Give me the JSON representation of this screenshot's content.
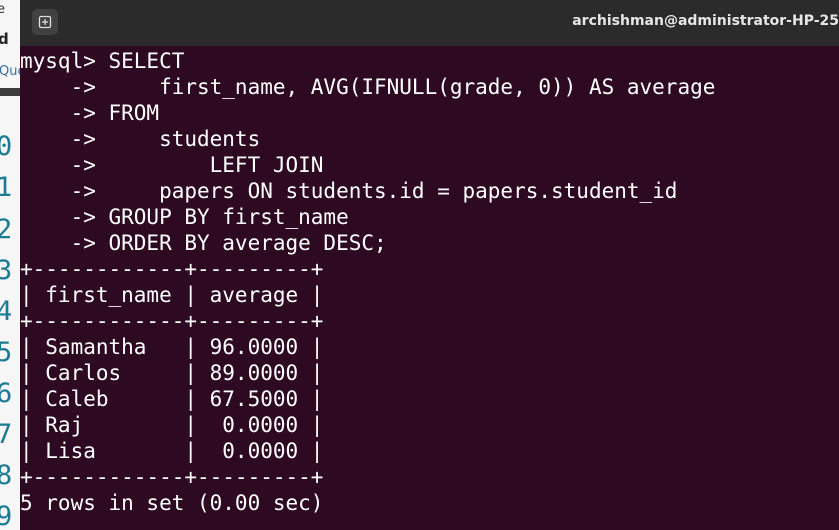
{
  "background_editor": {
    "partial_label_top": "e",
    "partial_label_tab": "d",
    "partial_label_query": "Que",
    "line_numbers": [
      "0",
      "1",
      "2",
      "3",
      "4",
      "5",
      "6",
      "7",
      "8",
      "9"
    ]
  },
  "terminal": {
    "title": "archishman@administrator-HP-25",
    "new_tab_icon": "new-tab-icon",
    "lines": [
      "mysql> SELECT",
      "    ->     first_name, AVG(IFNULL(grade, 0)) AS average",
      "    -> FROM",
      "    ->     students",
      "    ->         LEFT JOIN",
      "    ->     papers ON students.id = papers.student_id",
      "    -> GROUP BY first_name",
      "    -> ORDER BY average DESC;",
      "+------------+---------+",
      "| first_name | average |",
      "+------------+---------+",
      "| Samantha   | 96.0000 |",
      "| Carlos     | 89.0000 |",
      "| Caleb      | 67.5000 |",
      "| Raj        |  0.0000 |",
      "| Lisa       |  0.0000 |",
      "+------------+---------+",
      "5 rows in set (0.00 sec)"
    ]
  },
  "colors": {
    "terminal_background": "#2d0a22",
    "header_background": "#2b2b2b",
    "line_number_color": "#1b7a94"
  }
}
